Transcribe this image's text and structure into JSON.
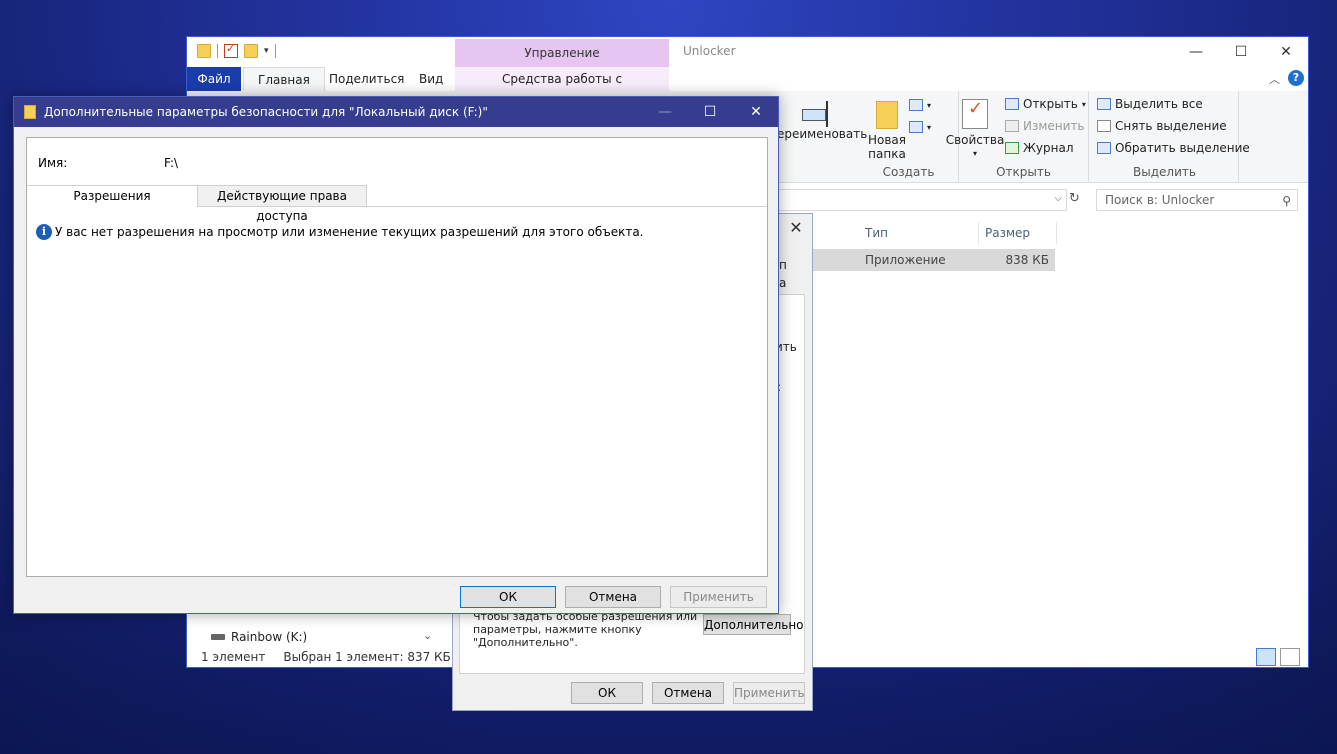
{
  "explorer": {
    "title": "Unlocker",
    "manage_tab": "Управление",
    "tabs": {
      "file": "Файл",
      "home": "Главная",
      "share": "Поделиться",
      "view": "Вид",
      "app_tools": "Средства работы с приложениями"
    },
    "help": "?",
    "ribbon": {
      "rename": "ереименовать",
      "new_folder_line1": "Новая",
      "new_folder_line2": "папка",
      "create_group": "Создать",
      "properties": "Свойства",
      "open": "Открыть",
      "edit": "Изменить",
      "history": "Журнал",
      "open_group": "Открыть",
      "select_all": "Выделить все",
      "select_none": "Снять выделение",
      "invert_selection": "Обратить выделение",
      "select_group": "Выделить"
    },
    "search_placeholder": "Поиск в: Unlocker",
    "columns": {
      "type": "Тип",
      "size": "Размер"
    },
    "file": {
      "type": "Приложение",
      "size": "838 КБ"
    },
    "nav_drive": "Rainbow (K:)",
    "status": {
      "count": "1 элемент",
      "selected": "Выбран 1 элемент: 837 КБ"
    }
  },
  "props_dialog": {
    "fragments": [
      "п",
      "а",
      "ить",
      ":"
    ],
    "advanced_text": "Чтобы задать особые разрешения или параметры, нажмите кнопку \"Дополнительно\".",
    "advanced_button": "Дополнительно",
    "ok": "ОК",
    "cancel": "Отмена",
    "apply": "Применить"
  },
  "security_dialog": {
    "title": "Дополнительные параметры безопасности  для \"Локальный диск (F:)\"",
    "name_label": "Имя:",
    "name_value": "F:\\",
    "tabs": [
      "Разрешения",
      "Действующие права доступа"
    ],
    "info_message": "У вас нет разрешения на просмотр или изменение текущих разрешений для этого объекта.",
    "ok": "ОК",
    "cancel": "Отмена",
    "apply": "Применить"
  }
}
